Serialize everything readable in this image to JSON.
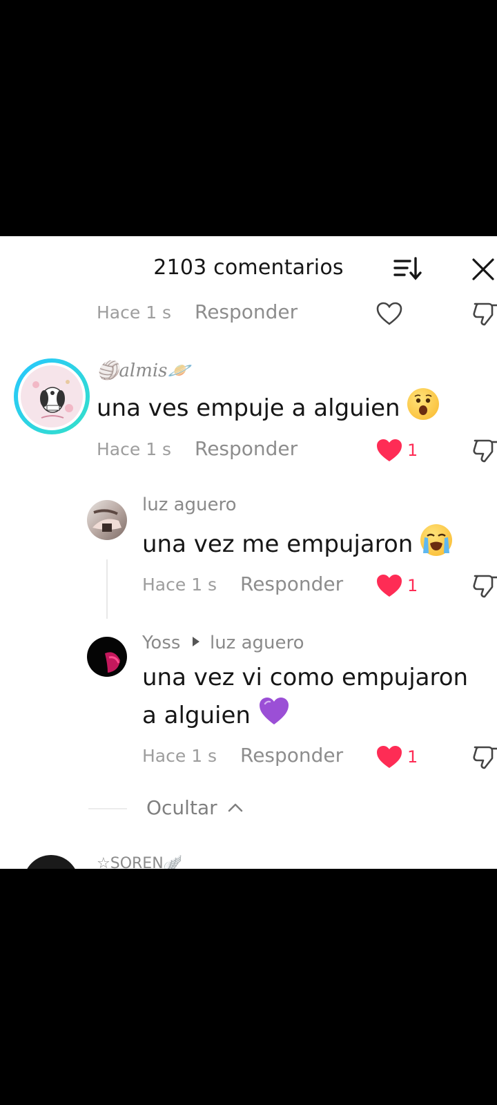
{
  "header": {
    "title": "2103 comentarios"
  },
  "prev_comment": {
    "time": "Hace 1 s",
    "reply_label": "Responder"
  },
  "comments": [
    {
      "username": "🏐almis🪐",
      "text": "una ves empuje a alguien",
      "emoji": "astonished-face",
      "time": "Hace 1 s",
      "reply_label": "Responder",
      "likes": "1"
    }
  ],
  "replies": [
    {
      "username": "luz aguero",
      "text": "una vez me empujaron",
      "emoji": "loudly-crying-face",
      "time": "Hace 1 s",
      "reply_label": "Responder",
      "likes": "1"
    },
    {
      "username": "Yoss",
      "reply_to": "luz aguero",
      "text_line1": "una vez vi como empujaron",
      "text_line2": "a alguien",
      "emoji": "purple-heart",
      "time": "Hace 1 s",
      "reply_label": "Responder",
      "likes": "1"
    }
  ],
  "hide_label": "Ocultar",
  "next_comment": {
    "username": "☆SOREN🪽"
  },
  "colors": {
    "like_red": "#fe2c55",
    "avatar_ring_start": "#27c6ff",
    "avatar_ring_end": "#34e0c8"
  }
}
